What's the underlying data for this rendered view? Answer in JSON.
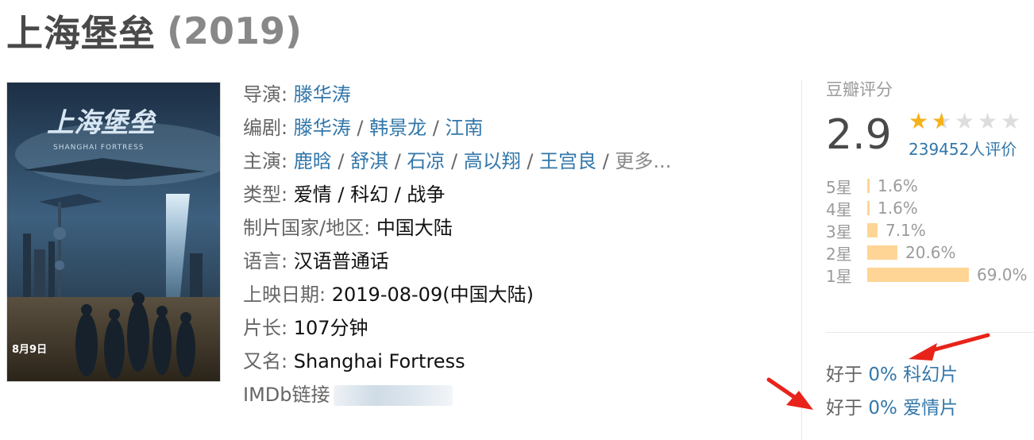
{
  "movie": {
    "title": "上海堡垒",
    "year": "(2019)"
  },
  "poster": {
    "title_art": "上海堡垒",
    "subtitle_art": "SHANGHAI FORTRESS",
    "date_art": "8月9日"
  },
  "info": {
    "director": {
      "label": "导演:",
      "names": [
        "滕华涛"
      ]
    },
    "writer": {
      "label": "编剧:",
      "names": [
        "滕华涛",
        "韩景龙",
        "江南"
      ]
    },
    "cast": {
      "label": "主演:",
      "names": [
        "鹿晗",
        "舒淇",
        "石凉",
        "高以翔",
        "王宫良"
      ],
      "more": "更多..."
    },
    "genre": {
      "label": "类型:",
      "value": "爱情 / 科幻 / 战争"
    },
    "country": {
      "label": "制片国家/地区:",
      "value": "中国大陆"
    },
    "language": {
      "label": "语言:",
      "value": "汉语普通话"
    },
    "release": {
      "label": "上映日期:",
      "value": "2019-08-09(中国大陆)"
    },
    "runtime": {
      "label": "片长:",
      "value": "107分钟"
    },
    "aka": {
      "label": "又名:",
      "value": "Shanghai Fortress"
    },
    "imdb": {
      "label": "IMDb链接"
    }
  },
  "rating": {
    "header": "豆瓣评分",
    "score": "2.9",
    "stars": 1.5,
    "votes": "239452人评价",
    "distribution": [
      {
        "label": "5星",
        "pct": "1.6%",
        "value": 1.6
      },
      {
        "label": "4星",
        "pct": "1.6%",
        "value": 1.6
      },
      {
        "label": "3星",
        "pct": "7.1%",
        "value": 7.1
      },
      {
        "label": "2星",
        "pct": "20.6%",
        "value": 20.6
      },
      {
        "label": "1星",
        "pct": "69.0%",
        "value": 69.0
      }
    ],
    "better_than": [
      {
        "prefix": "好于",
        "value": "0%",
        "category": "科幻片"
      },
      {
        "prefix": "好于",
        "value": "0%",
        "category": "爱情片"
      }
    ]
  },
  "colors": {
    "link": "#3377aa",
    "star": "#f6b21b",
    "bar": "#ffd596",
    "annotation": "#e8231a"
  }
}
